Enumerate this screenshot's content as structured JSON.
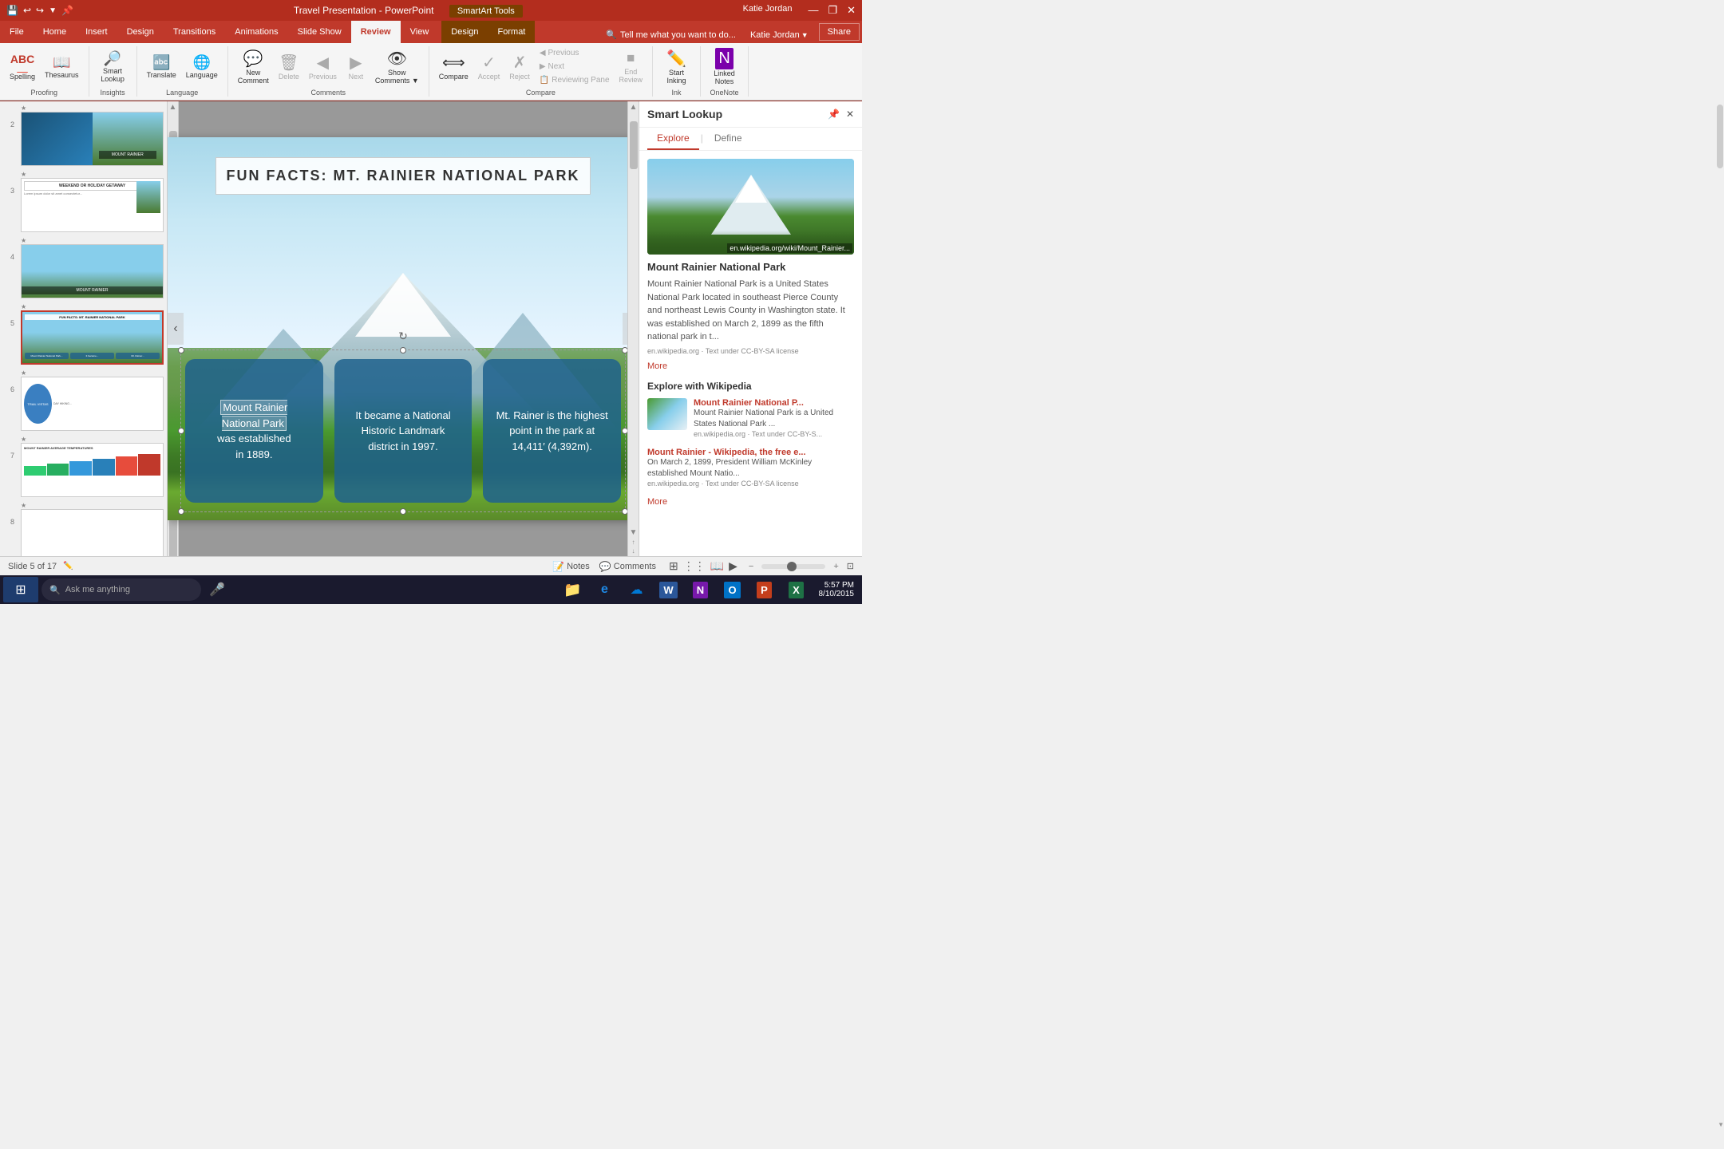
{
  "titlebar": {
    "title": "Travel Presentation - PowerPoint",
    "smartart_tools": "SmartArt Tools",
    "controls": [
      "—",
      "❐",
      "✕"
    ]
  },
  "ribbon": {
    "tabs": [
      "File",
      "Home",
      "Insert",
      "Design",
      "Transitions",
      "Animations",
      "Slide Show",
      "Review",
      "View",
      "Design",
      "Format"
    ],
    "active_tab": "Review",
    "smartart_active": true,
    "groups": {
      "proofing": {
        "label": "Proofing",
        "items": [
          {
            "id": "spelling",
            "label": "Spelling",
            "icon": "ABC"
          },
          {
            "id": "thesaurus",
            "label": "Thesaurus",
            "icon": "📖"
          }
        ]
      },
      "insights": {
        "label": "Insights",
        "items": [
          {
            "id": "smart-lookup",
            "label": "Smart\nLookup",
            "icon": "🔍"
          }
        ]
      },
      "language": {
        "label": "Language",
        "items": [
          {
            "id": "translate",
            "label": "Translate",
            "icon": "A→"
          },
          {
            "id": "language",
            "label": "Language",
            "icon": "🌐"
          }
        ]
      },
      "comments": {
        "label": "Comments",
        "items": [
          {
            "id": "new-comment",
            "label": "New\nComment",
            "icon": "💬"
          },
          {
            "id": "delete",
            "label": "Delete",
            "icon": "✕"
          },
          {
            "id": "previous",
            "label": "Previous",
            "icon": "◀"
          },
          {
            "id": "next",
            "label": "Next",
            "icon": "▶"
          },
          {
            "id": "show-comments",
            "label": "Show\nComments",
            "icon": "👁"
          }
        ]
      },
      "compare": {
        "label": "Compare",
        "items": [
          {
            "id": "compare",
            "label": "Compare",
            "icon": "⟺"
          },
          {
            "id": "accept",
            "label": "Accept",
            "icon": "✓"
          },
          {
            "id": "reject",
            "label": "Reject",
            "icon": "✗"
          },
          {
            "id": "previous2",
            "label": "Previous",
            "icon": "◀"
          },
          {
            "id": "next2",
            "label": "Next",
            "icon": "▶"
          },
          {
            "id": "reviewing-pane",
            "label": "Reviewing Pane",
            "icon": "📋"
          },
          {
            "id": "end-review",
            "label": "End\nReview",
            "icon": "⏹"
          }
        ]
      },
      "ink": {
        "label": "Ink",
        "items": [
          {
            "id": "start-inking",
            "label": "Start\nInking",
            "icon": "✏️"
          }
        ]
      },
      "onenote": {
        "label": "OneNote",
        "items": [
          {
            "id": "linked-notes",
            "label": "Linked\nNotes",
            "icon": "N"
          }
        ]
      }
    },
    "tell_me": "Tell me what you want to do...",
    "user": "Katie Jordan",
    "share": "Share"
  },
  "slides_panel": {
    "slides": [
      {
        "num": 2,
        "star": true,
        "type": "split"
      },
      {
        "num": 3,
        "star": true,
        "type": "weekend"
      },
      {
        "num": 4,
        "star": true,
        "type": "mountain"
      },
      {
        "num": 5,
        "star": true,
        "type": "facts",
        "active": true
      },
      {
        "num": 6,
        "star": true,
        "type": "trails"
      },
      {
        "num": 7,
        "star": true,
        "type": "temperatures"
      },
      {
        "num": 8,
        "star": true,
        "type": "blank"
      }
    ]
  },
  "main_slide": {
    "title": "FUN FACTS: MT. RAINIER NATIONAL PARK",
    "fact1": {
      "line1": "Mount Rainier",
      "line2": "National Park",
      "line3": "was  established",
      "line4": "in 1889."
    },
    "fact2": "It became a National Historic Landmark district in 1997.",
    "fact3": "Mt. Rainer is the highest point in the park at 14,411′ (4,392m)."
  },
  "smart_lookup": {
    "title": "Smart Lookup",
    "tabs": [
      "Explore",
      "Define"
    ],
    "active_tab": "Explore",
    "main_result": {
      "title": "Mount Rainier National Park",
      "description": "Mount Rainier National Park is a United States National Park located in southeast Pierce County and northeast Lewis County in Washington state. It was established on March 2, 1899 as the fifth national park in t...",
      "source": "en.wikipedia.org · Text under CC-BY-SA license"
    },
    "more_label": "More",
    "explore_section": "Explore with Wikipedia",
    "results": [
      {
        "title": "Mount Rainier National P...",
        "description": "Mount Rainier National Park is a United States National Park ...",
        "source": "en.wikipedia.org · Text under CC-BY-S..."
      },
      {
        "title": "Mount Rainier - Wikipedia, the free e...",
        "description": "On March 2, 1899, President William McKinley established Mount Natio...",
        "source": "en.wikipedia.org · Text under CC-BY-SA license"
      }
    ],
    "more_label2": "More"
  },
  "status_bar": {
    "slide_info": "Slide 5 of 17",
    "notes": "Notes",
    "comments": "Comments",
    "view_normal": "⊞",
    "view_outline": "≡",
    "view_reading": "📖",
    "zoom_level": "−        +",
    "time": "5:57 PM",
    "date": "8/10/2015"
  },
  "taskbar": {
    "search_placeholder": "Ask me anything",
    "apps": [
      {
        "name": "file-explorer",
        "icon": "📁",
        "color": "#f4a340"
      },
      {
        "name": "edge",
        "icon": "e",
        "color": "#1e88e5"
      },
      {
        "name": "onedrive",
        "icon": "☁",
        "color": "#0078d4"
      },
      {
        "name": "word",
        "icon": "W",
        "color": "#2b579a"
      },
      {
        "name": "onenote",
        "icon": "N",
        "color": "#7719aa"
      },
      {
        "name": "outlook",
        "icon": "O",
        "color": "#0072c6"
      },
      {
        "name": "powerpoint",
        "icon": "P",
        "color": "#c43e1c"
      },
      {
        "name": "excel",
        "icon": "X",
        "color": "#1e7145"
      }
    ]
  }
}
